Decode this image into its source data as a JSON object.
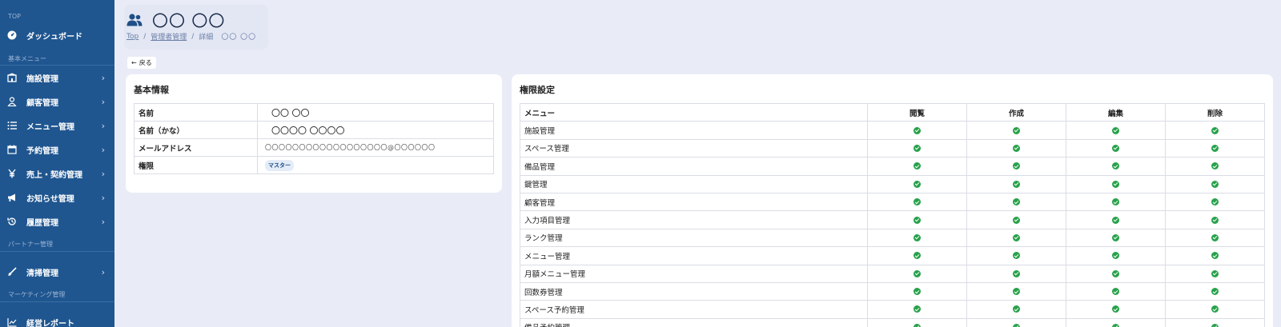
{
  "sidebar": {
    "sections": {
      "top": "TOP",
      "basic": "基本メニュー",
      "partner": "パートナー管理",
      "marketing": "マーケティング管理"
    },
    "items": [
      {
        "label": "ダッシュボード",
        "icon": "dashboard-icon"
      },
      {
        "label": "施設管理",
        "icon": "building-icon"
      },
      {
        "label": "顧客管理",
        "icon": "user-icon"
      },
      {
        "label": "メニュー管理",
        "icon": "list-icon"
      },
      {
        "label": "予約管理",
        "icon": "calendar-icon"
      },
      {
        "label": "売上・契約管理",
        "icon": "yen-icon"
      },
      {
        "label": "お知らせ管理",
        "icon": "megaphone-icon"
      },
      {
        "label": "履歴管理",
        "icon": "history-icon"
      },
      {
        "label": "清掃管理",
        "icon": "brush-icon"
      },
      {
        "label": "経営レポート",
        "icon": "chart-line-icon"
      }
    ],
    "chevron": "›"
  },
  "header": {
    "title": "〇〇 〇〇",
    "icon": "users-icon",
    "breadcrumb": {
      "top": "Top",
      "sep": "/",
      "admin": "管理者管理",
      "detail": "詳細",
      "current": "〇〇 〇〇"
    }
  },
  "back_button": {
    "arrow": "←",
    "label": "戻る"
  },
  "basic_info": {
    "title": "基本情報",
    "rows": [
      {
        "key": "名前",
        "value": "〇〇 〇〇"
      },
      {
        "key": "名前（かな）",
        "value": "〇〇〇〇 〇〇〇〇"
      },
      {
        "key": "メールアドレス",
        "value": "〇〇〇〇〇〇〇〇〇〇〇〇〇〇〇〇〇〇@〇〇〇〇〇〇"
      },
      {
        "key": "権限",
        "value": "マスター"
      }
    ]
  },
  "permissions": {
    "title": "権限設定",
    "headers": {
      "menu": "メニュー",
      "view": "閲覧",
      "create": "作成",
      "edit": "編集",
      "delete": "削除"
    },
    "rows": [
      "施設管理",
      "スペース管理",
      "備品管理",
      "鍵管理",
      "顧客管理",
      "入力項目管理",
      "ランク管理",
      "メニュー管理",
      "月額メニュー管理",
      "回数券管理",
      "スペース予約管理",
      "備品予約管理"
    ]
  },
  "colors": {
    "sidebar": "#1f5690",
    "background": "#e9ecf6",
    "check": "#27a24a"
  }
}
